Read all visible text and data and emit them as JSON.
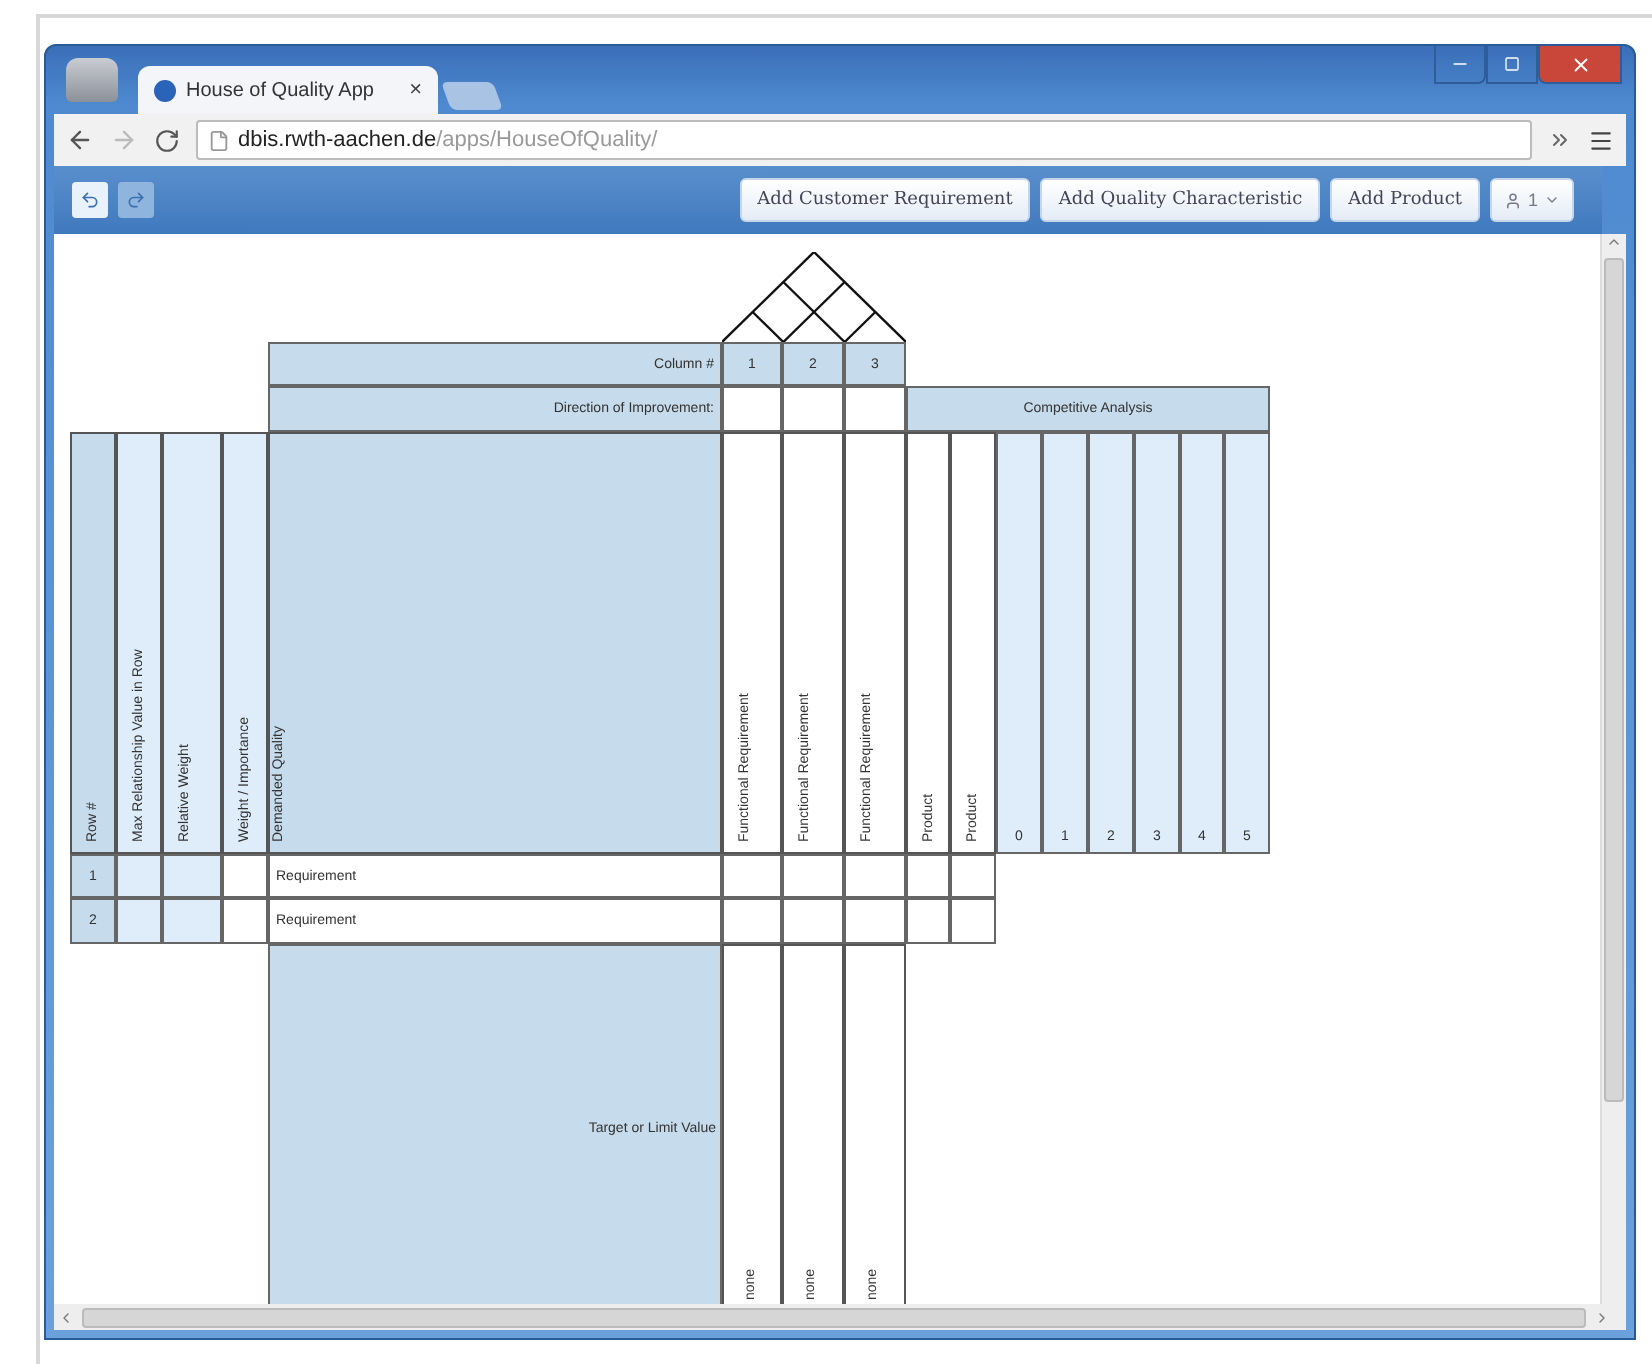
{
  "window": {
    "tab_title": "House of Quality App",
    "tab_close": "×"
  },
  "address_bar": {
    "host": "dbis.rwth-aachen.de",
    "path": "/apps/HouseOfQuality/"
  },
  "toolbar": {
    "buttons": [
      "Add Customer Requirement",
      "Add Quality Characteristic",
      "Add Product"
    ],
    "user_menu": "1"
  },
  "house": {
    "column_label": "Column #",
    "direction_label": "Direction of Improvement:",
    "competitive_label": "Competitive Analysis",
    "row_headers": [
      "Row #",
      "Max Relationship Value in Row",
      "Relative Weight",
      "Weight / Importance",
      "Demanded Quality"
    ],
    "characteristics": [
      {
        "number": "1",
        "name": "Functional Requirement",
        "target": "none"
      },
      {
        "number": "2",
        "name": "Functional Requirement",
        "target": "none"
      },
      {
        "number": "3",
        "name": "Functional Requirement",
        "target": "none"
      }
    ],
    "products": [
      "Product",
      "Product"
    ],
    "scale": [
      "0",
      "1",
      "2",
      "3",
      "4",
      "5"
    ],
    "rows": [
      {
        "number": "1",
        "requirement": "Requirement"
      },
      {
        "number": "2",
        "requirement": "Requirement"
      }
    ],
    "target_label": "Target or Limit Value"
  }
}
